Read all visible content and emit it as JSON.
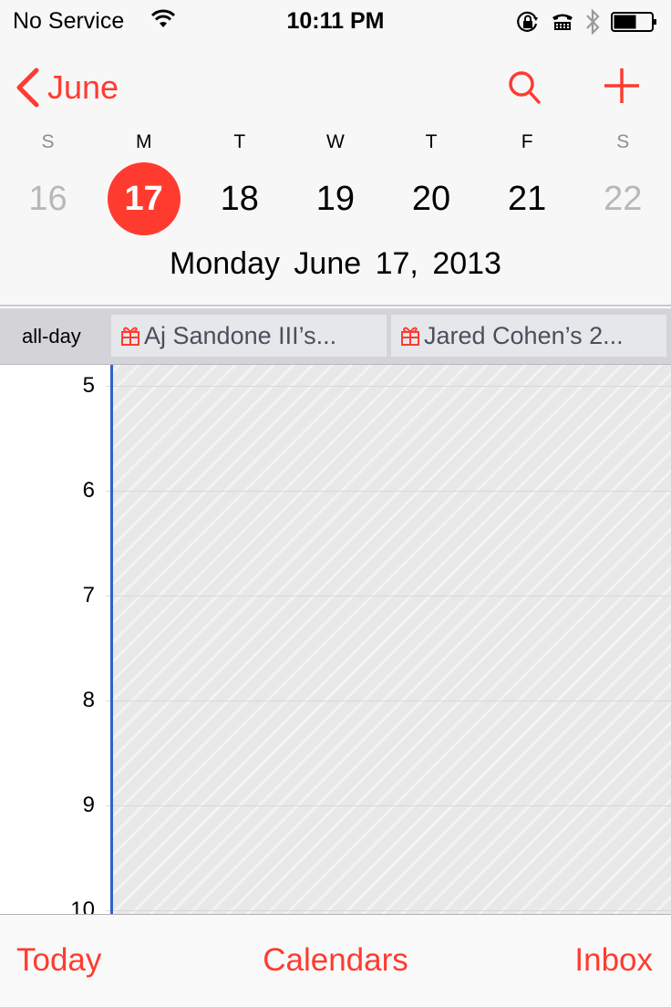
{
  "status_bar": {
    "carrier": "No Service",
    "time": "10:11 PM",
    "icons": [
      "wifi-icon",
      "orientation-lock-icon",
      "tty-icon",
      "bluetooth-icon",
      "battery-icon"
    ],
    "battery_level": 0.6
  },
  "nav": {
    "back_label": "June",
    "search_icon": "search-icon",
    "add_icon": "plus-icon"
  },
  "week": {
    "weekdays": [
      "S",
      "M",
      "T",
      "W",
      "T",
      "F",
      "S"
    ],
    "days": [
      "16",
      "17",
      "18",
      "19",
      "20",
      "21",
      "22"
    ],
    "selected_index": 1
  },
  "date_title": "Monday  June 17, 2013",
  "all_day": {
    "label": "all-day",
    "events": [
      {
        "title": "Aj Sandone III’s...",
        "icon": "gift-icon"
      },
      {
        "title": "Jared Cohen’s 2...",
        "icon": "gift-icon"
      }
    ]
  },
  "hours": [
    "5",
    "6",
    "7",
    "8",
    "9",
    "10"
  ],
  "toolbar": {
    "today": "Today",
    "calendars": "Calendars",
    "inbox": "Inbox"
  },
  "colors": {
    "accent": "#ff3b30",
    "current_line": "#2f63c7"
  }
}
